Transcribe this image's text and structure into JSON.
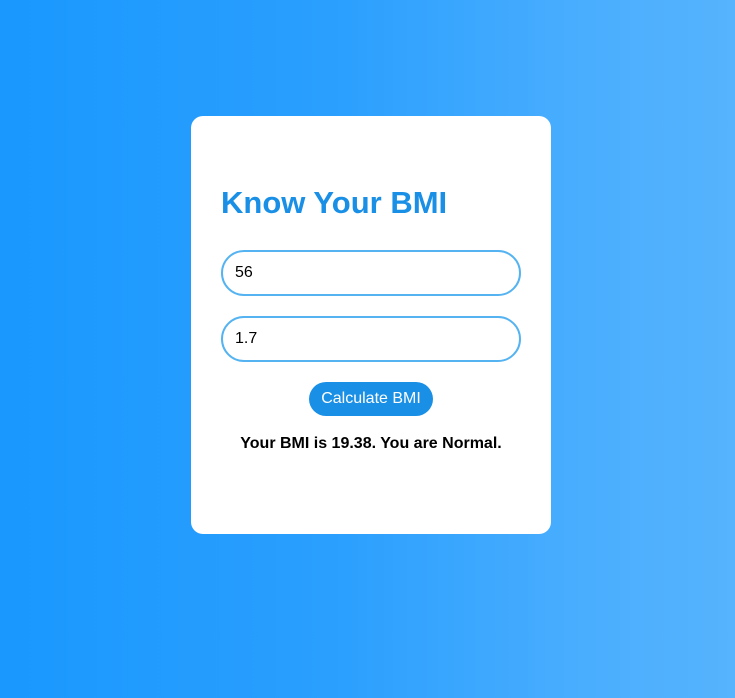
{
  "card": {
    "title": "Know Your BMI",
    "weight_input": {
      "value": "56"
    },
    "height_input": {
      "value": "1.7"
    },
    "calculate_label": "Calculate BMI",
    "result_text": "Your BMI is 19.38. You are Normal."
  },
  "colors": {
    "accent": "#1a8fe6",
    "input_border": "#55b3f1",
    "background_start": "#1a98fe",
    "background_end": "#56b3fd",
    "card_background": "#ffffff"
  }
}
